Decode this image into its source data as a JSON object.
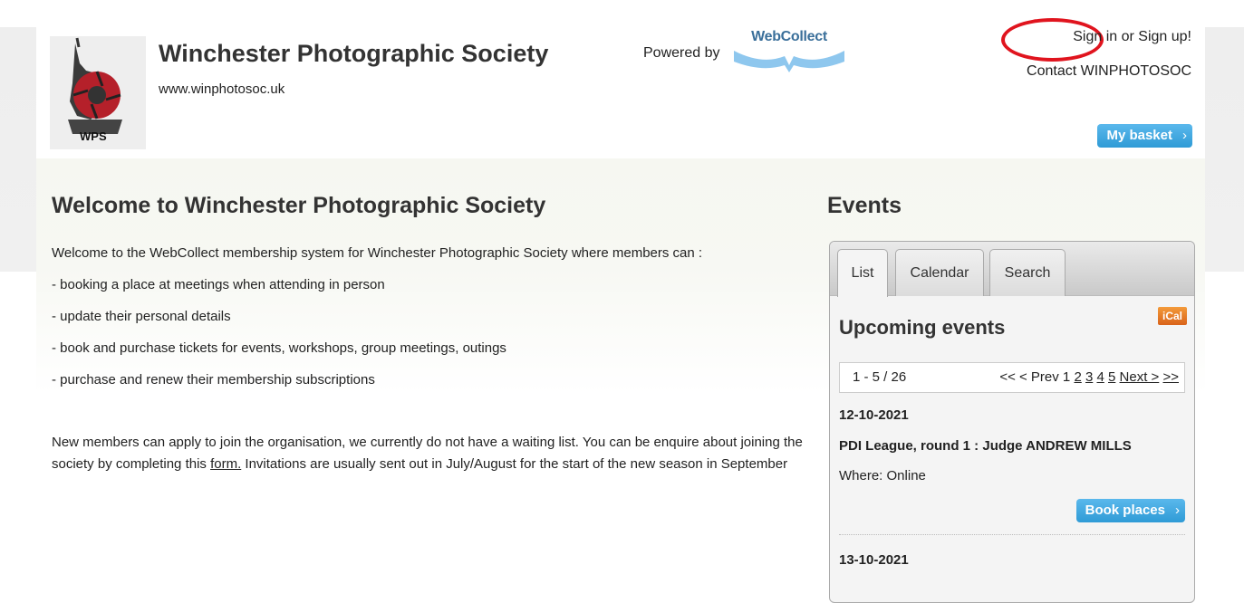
{
  "header": {
    "logo_text": "WPS",
    "org_title": "Winchester Photographic Society",
    "org_url": "www.winphotosoc.uk",
    "powered_by": "Powered by",
    "webcollect_logo": "WebCollect",
    "sign_in": "Sign in",
    "or": " or ",
    "sign_up": "Sign up!",
    "contact": "Contact WINPHOTOSOC",
    "basket": "My basket",
    "chevron": "›"
  },
  "main": {
    "title": "Welcome to Winchester Photographic Society",
    "intro": "Welcome to the WebCollect membership system for Winchester Photographic Society where  members can :",
    "bullets": [
      "- booking a place at meetings when attending in person",
      "- update their personal details",
      "- book and purchase tickets for events, workshops, group meetings, outings",
      "- purchase and renew their membership subscriptions"
    ],
    "para_before_link": "New members can apply to join the organisation, we currently do not have a waiting list. You can be enquire about joining the society by completing this ",
    "form_link": "form.",
    "para_after_link": " Invitations are usually sent out in July/August for the start of the new season in September"
  },
  "events": {
    "title": "Events",
    "tabs": [
      "List",
      "Calendar",
      "Search"
    ],
    "active_tab": "List",
    "upcoming_title": "Upcoming events",
    "ical_label": "iCal",
    "pager": {
      "range": "1 - 5 / 26",
      "prev": "<< < Prev 1 ",
      "pages": [
        "2",
        "3",
        "4",
        "5"
      ],
      "next": "Next >",
      "last": ">>"
    },
    "items": [
      {
        "date": "12-10-2021",
        "title": "PDI League, round 1 : Judge ANDREW MILLS",
        "where": "Where: Online",
        "button": "Book places"
      },
      {
        "date": "13-10-2021"
      }
    ]
  },
  "colors": {
    "button_blue": "#3aa5e0",
    "annotation_red": "#e0141e",
    "ical_orange": "#e8782a"
  }
}
